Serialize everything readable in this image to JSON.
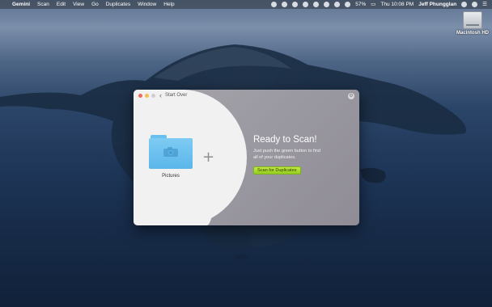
{
  "menubar": {
    "apple": "",
    "app_name": "Gemini",
    "items": [
      "Scan",
      "Edit",
      "View",
      "Go",
      "Duplicates",
      "Window",
      "Help"
    ],
    "battery": "57%",
    "datetime": "Thu 10:08 PM",
    "user": "Jeff Phungglan"
  },
  "desktop": {
    "drive_label": "Macintosh HD"
  },
  "window": {
    "start_over": "Start Over",
    "folder_label": "Pictures",
    "ready_title": "Ready to Scan!",
    "subtitle_line1": "Just push the green button to find",
    "subtitle_line2": "all of your duplicates.",
    "scan_button": "Scan for Duplicates"
  },
  "colors": {
    "scan_button": "#a6d92b",
    "folder_blue": "#6cc1f0",
    "close": "#ec6a5e",
    "minimize": "#f4bf4f"
  }
}
